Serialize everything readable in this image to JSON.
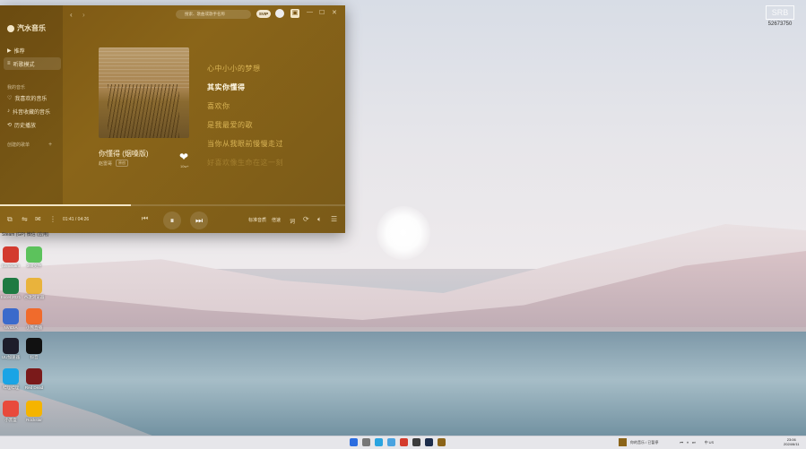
{
  "app": {
    "title": "汽水音乐",
    "search_placeholder": "搜索、歌曲或歌手名称",
    "vip_label": "SVIP",
    "nav": [
      {
        "label": "推荐",
        "icon": "play-icon"
      },
      {
        "label": "听歌模式",
        "icon": "list-icon",
        "active": true
      }
    ],
    "section_my_music": "我的音乐",
    "my_items": [
      {
        "label": "我喜欢的音乐",
        "icon": "heart-icon"
      },
      {
        "label": "抖音收藏的音乐",
        "icon": "music-icon"
      },
      {
        "label": "历史播放",
        "icon": "history-icon"
      }
    ],
    "section_playlists": "创建的歌单",
    "song": {
      "title": "你懂得 (烟嗓版)",
      "artist": "赵雷哥",
      "tag": "原创",
      "like_count": "10w+"
    },
    "lyrics": [
      {
        "text": "心中小小的梦想",
        "state": "past"
      },
      {
        "text": "其实你懂得",
        "state": "current"
      },
      {
        "text": "喜欢你",
        "state": "upcoming"
      },
      {
        "text": "是我最爱的歌",
        "state": "upcoming"
      },
      {
        "text": "当你从我眼前慢慢走过",
        "state": "upcoming"
      },
      {
        "text": "好喜欢像生命在这一刻",
        "state": "fade"
      }
    ],
    "player": {
      "time": "01:41 / 04:26",
      "progress": 0.38,
      "quality_label": "标准音质",
      "speed_label": "倍速",
      "lyric_label": "词"
    }
  },
  "watermark": {
    "logo": "SRB",
    "id": "52673750"
  },
  "desktop": {
    "top_label": "Steam (GP)   微信 (应用)",
    "icons": [
      {
        "label": "Bandicam",
        "color": "#d33a2f"
      },
      {
        "label": "360文件",
        "color": "#5cc25c"
      },
      {
        "label": "Excel 2021",
        "color": "#1f7a42"
      },
      {
        "label": "谷歌浏览器",
        "color": "#e9b33c"
      },
      {
        "label": "NVIDIA",
        "color": "#3b6acb"
      },
      {
        "label": "小熊直播",
        "color": "#f06b2c"
      },
      {
        "label": "UU加速器",
        "color": "#1d1d2a"
      },
      {
        "label": "抖音",
        "color": "#111111"
      },
      {
        "label": "哔哩哔哩",
        "color": "#1aa4e5"
      },
      {
        "label": "Red Dead",
        "color": "#7a1a1a"
      },
      {
        "label": "小黑盒",
        "color": "#e84a3c"
      },
      {
        "label": "Rockstar",
        "color": "#f5b400"
      }
    ]
  },
  "taskbar": {
    "notify_text": "你的音乐 / 已暂停",
    "lang": "中\nUS",
    "time": "23:06",
    "date": "2024/6/11"
  }
}
